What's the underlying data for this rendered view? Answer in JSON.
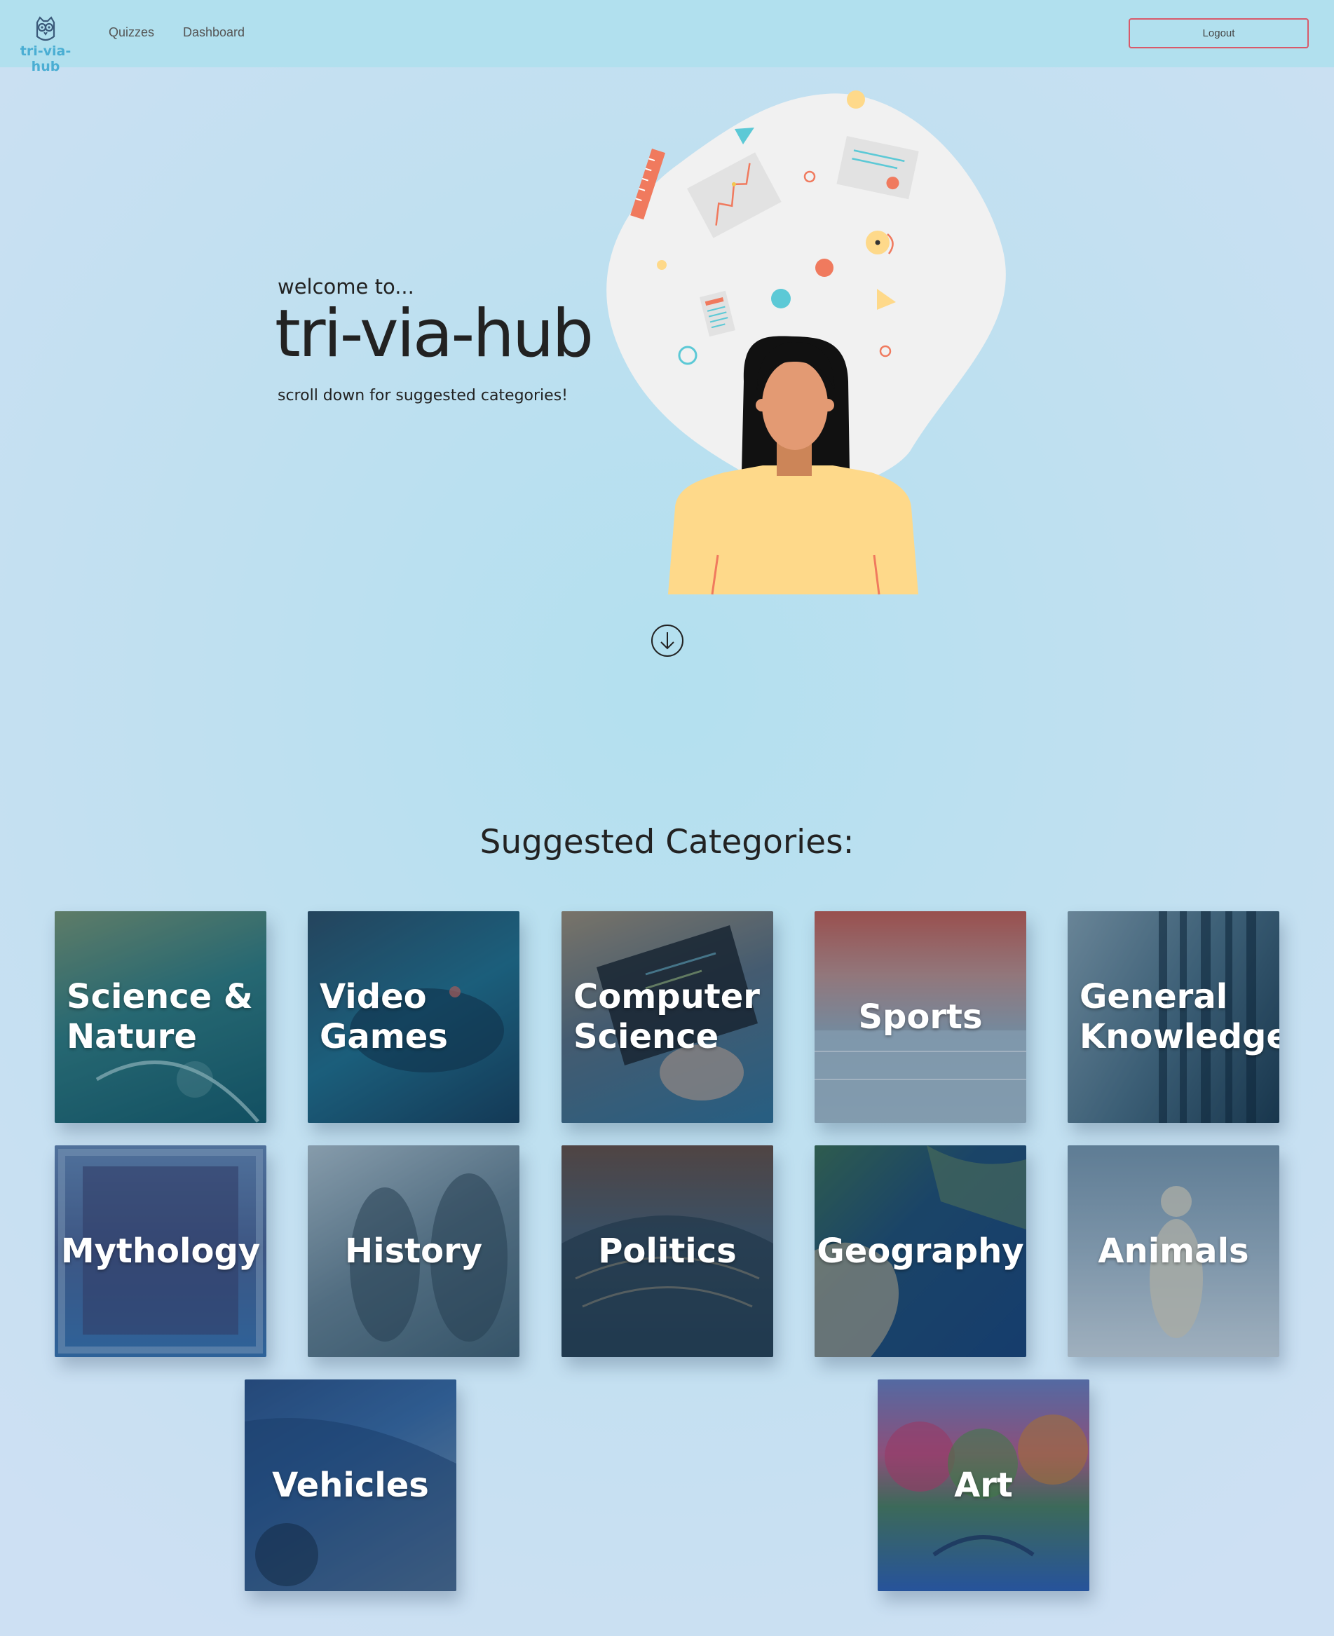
{
  "navbar": {
    "brand": "tri-via-hub",
    "links": [
      {
        "label": "Quizzes"
      },
      {
        "label": "Dashboard"
      }
    ],
    "logout_label": "Logout"
  },
  "hero": {
    "welcome": "welcome to...",
    "title": "tri-via-hub",
    "subtitle": "scroll down for suggested categories!"
  },
  "categories_section": {
    "title": "Suggested Categories:",
    "items": [
      {
        "label": "Science & Nature",
        "icon": "science-nature-image"
      },
      {
        "label": "Video Games",
        "icon": "video-games-image"
      },
      {
        "label": "Computer Science",
        "icon": "computer-science-image"
      },
      {
        "label": "Sports",
        "icon": "sports-image"
      },
      {
        "label": "General Knowledge",
        "icon": "general-knowledge-image"
      },
      {
        "label": "Mythology",
        "icon": "mythology-image"
      },
      {
        "label": "History",
        "icon": "history-image"
      },
      {
        "label": "Politics",
        "icon": "politics-image"
      },
      {
        "label": "Geography",
        "icon": "geography-image"
      },
      {
        "label": "Animals",
        "icon": "animals-image"
      },
      {
        "label": "Vehicles",
        "icon": "vehicles-image"
      },
      {
        "label": "Art",
        "icon": "art-image"
      }
    ]
  },
  "colors": {
    "brand": "#4aaed3",
    "logout_border": "#d85a6a",
    "navbar_bg": "#b1e0ee"
  }
}
